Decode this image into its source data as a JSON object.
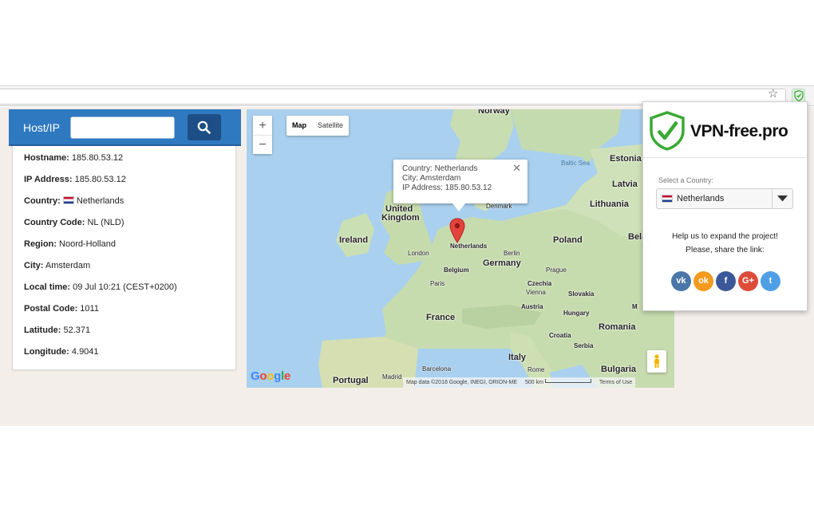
{
  "browser": {
    "star_icon": "star-icon",
    "extension_icon": "shield-check-icon"
  },
  "search": {
    "label": "Host/IP",
    "input_value": "",
    "button_icon": "search-icon"
  },
  "info": {
    "hostname": {
      "label": "Hostname:",
      "value": "185.80.53.12"
    },
    "ip_address": {
      "label": "IP Address:",
      "value": "185.80.53.12"
    },
    "country": {
      "label": "Country:",
      "value": "Netherlands"
    },
    "country_code": {
      "label": "Country Code:",
      "value": "NL (NLD)"
    },
    "region": {
      "label": "Region:",
      "value": "Noord-Holland"
    },
    "city": {
      "label": "City:",
      "value": "Amsterdam"
    },
    "local_time": {
      "label": "Local time:",
      "value": "09 Jul 10:21 (CEST+0200)"
    },
    "postal_code": {
      "label": "Postal Code:",
      "value": "1011"
    },
    "latitude": {
      "label": "Latitude:",
      "value": "52.371"
    },
    "longitude": {
      "label": "Longitude:",
      "value": "4.9041"
    }
  },
  "map": {
    "zoom_in": "+",
    "zoom_out": "−",
    "type_map": "Map",
    "type_satellite": "Satellite",
    "infowindow": {
      "country": "Country: Netherlands",
      "city": "City: Amsterdam",
      "ip": "IP Address: 185.80.53.12",
      "close": "✕"
    },
    "labels": {
      "norway": "Norway",
      "estonia": "Estonia",
      "latvia": "Latvia",
      "lithuania": "Lithuania",
      "denmark": "Denmark",
      "baltic_sea": "Baltic Sea",
      "united": "United",
      "kingdom": "Kingdom",
      "ireland": "Ireland",
      "london": "London",
      "netherlands": "Netherlands",
      "berlin": "Berlin",
      "poland": "Poland",
      "bela": "Bela",
      "belgium": "Belgium",
      "germany": "Germany",
      "prague": "Prague",
      "czechia": "Czechia",
      "paris": "Paris",
      "vienna": "Vienna",
      "slovakia": "Slovakia",
      "austria": "Austria",
      "hungary": "Hungary",
      "m": "M",
      "france": "France",
      "croatia": "Croatia",
      "romania": "Romania",
      "serbia": "Serbia",
      "italy": "Italy",
      "barcelona": "Barcelona",
      "rome": "Rome",
      "bulgaria": "Bulgaria",
      "portugal": "Portugal",
      "madrid": "Madrid"
    },
    "google": "Google",
    "attribution": "Map data ©2018 Google, INEGI, ORION-ME",
    "scale": "500 km",
    "terms": "Terms of Use"
  },
  "popup": {
    "brand": "VPN-free.pro",
    "select_label": "Select a Country:",
    "selected_country": "Netherlands",
    "promo_line1": "Help us to expand the project!",
    "promo_line2": "Please, share the link:",
    "socials": [
      {
        "name": "vk",
        "glyph": "vk",
        "color": "#4a76a8"
      },
      {
        "name": "odnoklassniki",
        "glyph": "ok",
        "color": "#f49a1e"
      },
      {
        "name": "facebook",
        "glyph": "f",
        "color": "#3b5998"
      },
      {
        "name": "google-plus",
        "glyph": "G+",
        "color": "#dd4b39"
      },
      {
        "name": "twitter",
        "glyph": "t",
        "color": "#4e9fe5"
      }
    ]
  },
  "colors": {
    "header_blue": "#2f79c0",
    "button_dark_blue": "#1d4f86",
    "vpn_green": "#3aa935",
    "pin_red": "#e4433d"
  }
}
